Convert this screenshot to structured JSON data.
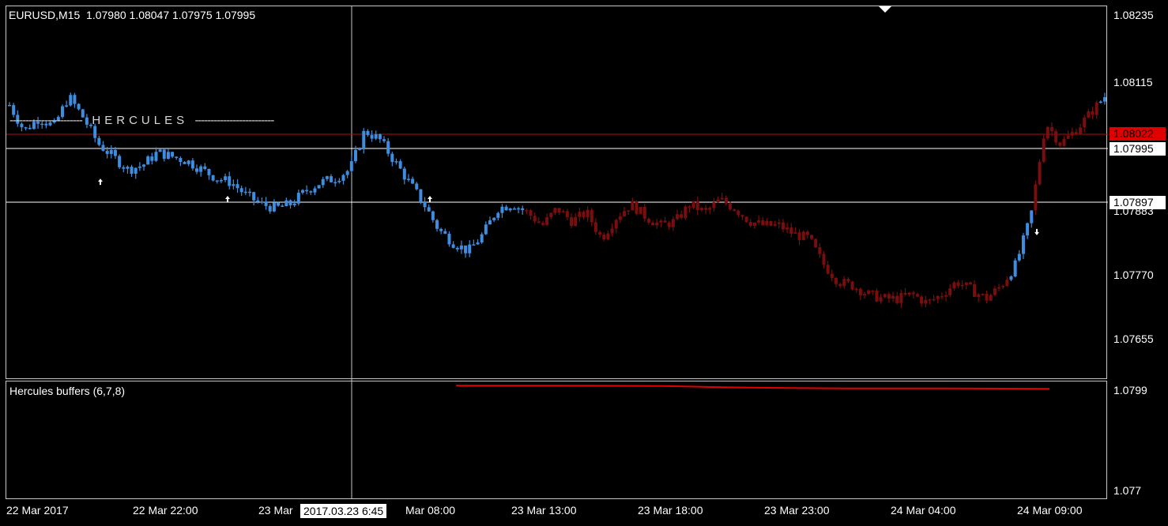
{
  "chart_header": {
    "symbol_tf": "EURUSD,M15",
    "ohlc": "1.07980 1.08047 1.07975 1.07995"
  },
  "indicator_label": "HERCULES",
  "sub_window": {
    "title": "Hercules buffers (6,7,8)",
    "scale_top": "1.0799",
    "scale_bottom": "1.077"
  },
  "price_axis": {
    "ticks": [
      "1.08235",
      "1.08115",
      "1.07883",
      "1.07770",
      "1.07655"
    ],
    "current_bid": "1.08022",
    "hline_1": "1.07995",
    "hline_2": "1.07897"
  },
  "time_axis": {
    "ticks": [
      "22 Mar 2017",
      "22 Mar 22:00",
      "23 Mar",
      "Mar 08:00",
      "23 Mar 13:00",
      "23 Mar 18:00",
      "23 Mar 23:00",
      "24 Mar 04:00",
      "24 Mar 09:00"
    ],
    "crosshair_time": "2017.03.23 6:45"
  },
  "colors": {
    "bull": "#3d8ee0",
    "bear": "#7a0d0d",
    "bid_line": "#b01010",
    "bid_box": "#e00000",
    "hline": "#ffffff",
    "indicator_line": "#e00000"
  },
  "chart_data": {
    "type": "bar",
    "symbol": "EURUSD",
    "timeframe": "M15",
    "ylim": [
      1.0756,
      1.0825
    ],
    "price_ticks": [
      1.08235,
      1.08115,
      1.07883,
      1.0777,
      1.07655
    ],
    "horizontal_lines": [
      1.08022,
      1.07995,
      1.07897
    ],
    "close_path": [
      1.0809,
      1.0803,
      1.0806,
      1.0804,
      1.0811,
      1.0806,
      1.08,
      1.0797,
      1.0794,
      1.0795,
      1.0798,
      1.0797,
      1.0796,
      1.0794,
      1.0792,
      1.0791,
      1.0788,
      1.0786,
      1.0785,
      1.0786,
      1.0789,
      1.0791,
      1.0792,
      1.0794,
      1.0803,
      1.0801,
      1.0796,
      1.0791,
      1.0786,
      1.078,
      1.0777,
      1.0775,
      1.0779,
      1.0785,
      1.0786,
      1.0784,
      1.0781,
      1.0785,
      1.0782,
      1.0784,
      1.0778,
      1.0783,
      1.0786,
      1.0783,
      1.0781,
      1.0782,
      1.0786,
      1.0784,
      1.0787,
      1.0785,
      1.0782,
      1.0781,
      1.0781,
      1.0779,
      1.0778,
      1.0772,
      1.0768,
      1.0767,
      1.0765,
      1.0764,
      1.0764,
      1.0765,
      1.0763,
      1.0765,
      1.0768,
      1.0766,
      1.0764,
      1.0767,
      1.0772,
      1.0783,
      1.0805,
      1.08,
      1.0803,
      1.0807,
      1.0811
    ],
    "buy_arrows": [
      1.0793,
      1.0789,
      1.0789
    ],
    "sell_arrows": [
      1.0778
    ],
    "indicator": {
      "name": "Hercules buffers (6,7,8)",
      "ylim": [
        1.077,
        1.0799
      ],
      "values": [
        1.07994,
        1.07994,
        1.07993,
        1.0799,
        1.07988,
        1.07987,
        1.07986,
        1.07986,
        1.07985
      ]
    }
  }
}
